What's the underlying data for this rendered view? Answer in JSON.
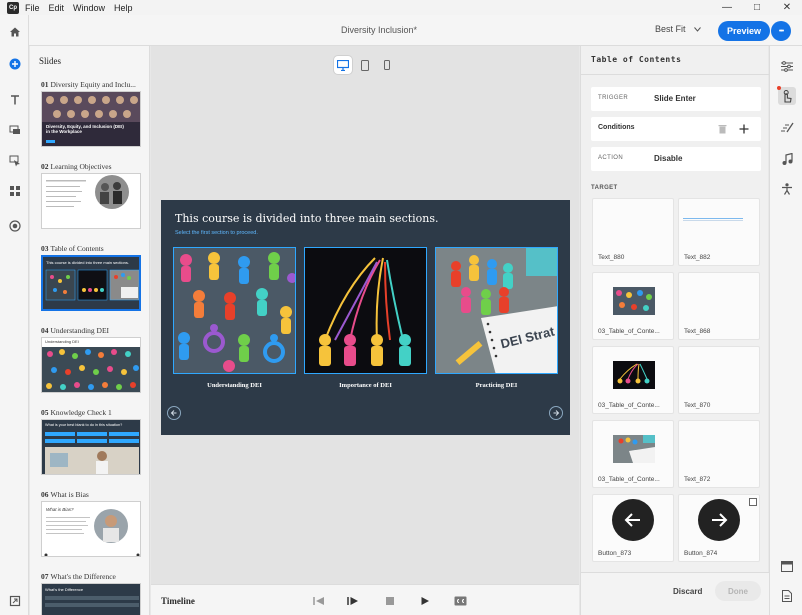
{
  "menubar": {
    "logo": "Cp",
    "items": [
      "File",
      "Edit",
      "Window",
      "Help"
    ],
    "controls": {
      "minimize": "—",
      "maximize": "□",
      "close": "✕"
    }
  },
  "titlebar": {
    "document_title": "Diversity Inclusion*",
    "fit_value": "Best Fit",
    "preview_label": "Preview",
    "more_label": "•••"
  },
  "slides": {
    "panel_title": "Slides",
    "items": [
      {
        "num": "01",
        "title": "Diversity Equity and Inclu..."
      },
      {
        "num": "02",
        "title": "Learning Objectives"
      },
      {
        "num": "03",
        "title": "Table of Contents"
      },
      {
        "num": "04",
        "title": "Understanding DEI"
      },
      {
        "num": "05",
        "title": "Knowledge Check 1"
      },
      {
        "num": "06",
        "title": "What is Bias"
      },
      {
        "num": "07",
        "title": "What's the Difference"
      }
    ],
    "thumb_text": {
      "s1_title": "Diversity, Equity, and Inclusion (DEI) in the Workplace",
      "s3_title": "This course is divided into three main sections.",
      "s4_title": "Understanding DEI",
      "s5_title": "What is your best blank to do in this situation?",
      "s6_title": "What is Bias?",
      "s7_title": "What's the Difference"
    }
  },
  "stage": {
    "heading": "This course is divided into three main sections.",
    "subheading": "Select the first section to proceed.",
    "cards": [
      {
        "label": "Understanding DEI"
      },
      {
        "label": "Importance of DEI"
      },
      {
        "label": "Practicing DEI"
      }
    ],
    "card3_overlay": "DEI Strat"
  },
  "timeline": {
    "label": "Timeline"
  },
  "properties": {
    "title": "Table of Contents",
    "trigger_key": "TRIGGER",
    "trigger_value": "Slide Enter",
    "conditions_key": "Conditions",
    "action_key": "ACTION",
    "action_value": "Disable",
    "target_label": "TARGET",
    "targets": [
      {
        "name": "Text_880"
      },
      {
        "name": "Text_882"
      },
      {
        "name": "03_Table_of_Conte..."
      },
      {
        "name": "Text_868"
      },
      {
        "name": "03_Table_of_Conte..."
      },
      {
        "name": "Text_870"
      },
      {
        "name": "03_Table_of_Conte..."
      },
      {
        "name": "Text_872"
      },
      {
        "name": "Button_873"
      },
      {
        "name": "Button_874"
      }
    ],
    "discard_label": "Discard",
    "done_label": "Done"
  },
  "colors": {
    "accent": "#1473e6",
    "stage_bg": "#2d3a48",
    "card_border": "#2fa8ff"
  }
}
